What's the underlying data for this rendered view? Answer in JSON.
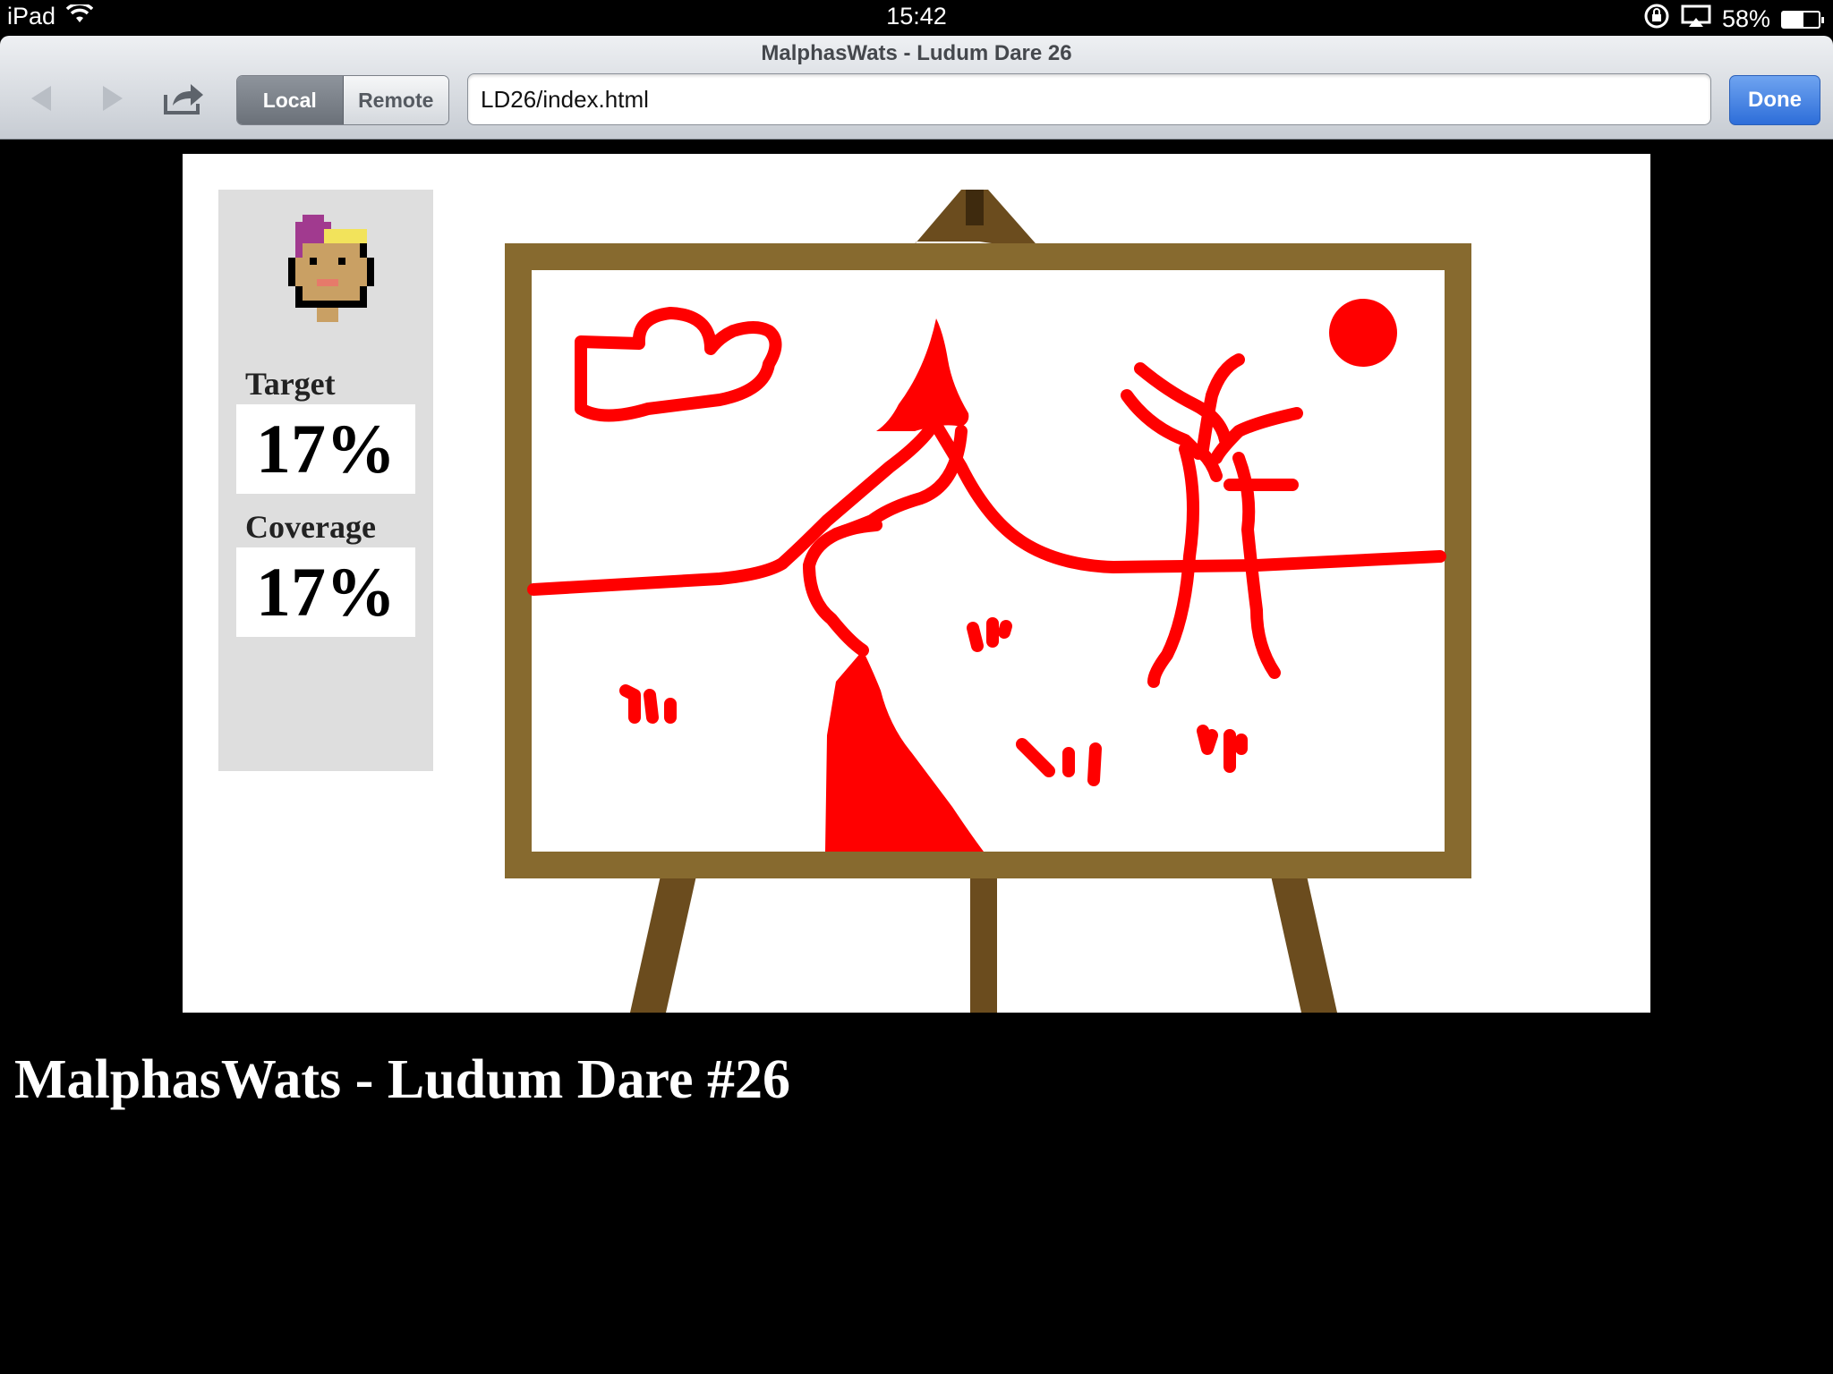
{
  "status": {
    "device": "iPad",
    "time": "15:42",
    "battery": "58%",
    "battery_level": 0.58
  },
  "browser": {
    "title": "MalphasWats - Ludum Dare 26",
    "segments": [
      {
        "label": "Local",
        "active": true
      },
      {
        "label": "Remote",
        "active": false
      }
    ],
    "url": "LD26/index.html",
    "done_label": "Done"
  },
  "game": {
    "target_label": "Target",
    "target_value": "17%",
    "coverage_label": "Coverage",
    "coverage_value": "17%",
    "paint_color": "#ff0000",
    "easel_color": "#876a2f"
  },
  "page": {
    "heading": "MalphasWats - Ludum Dare #26"
  }
}
